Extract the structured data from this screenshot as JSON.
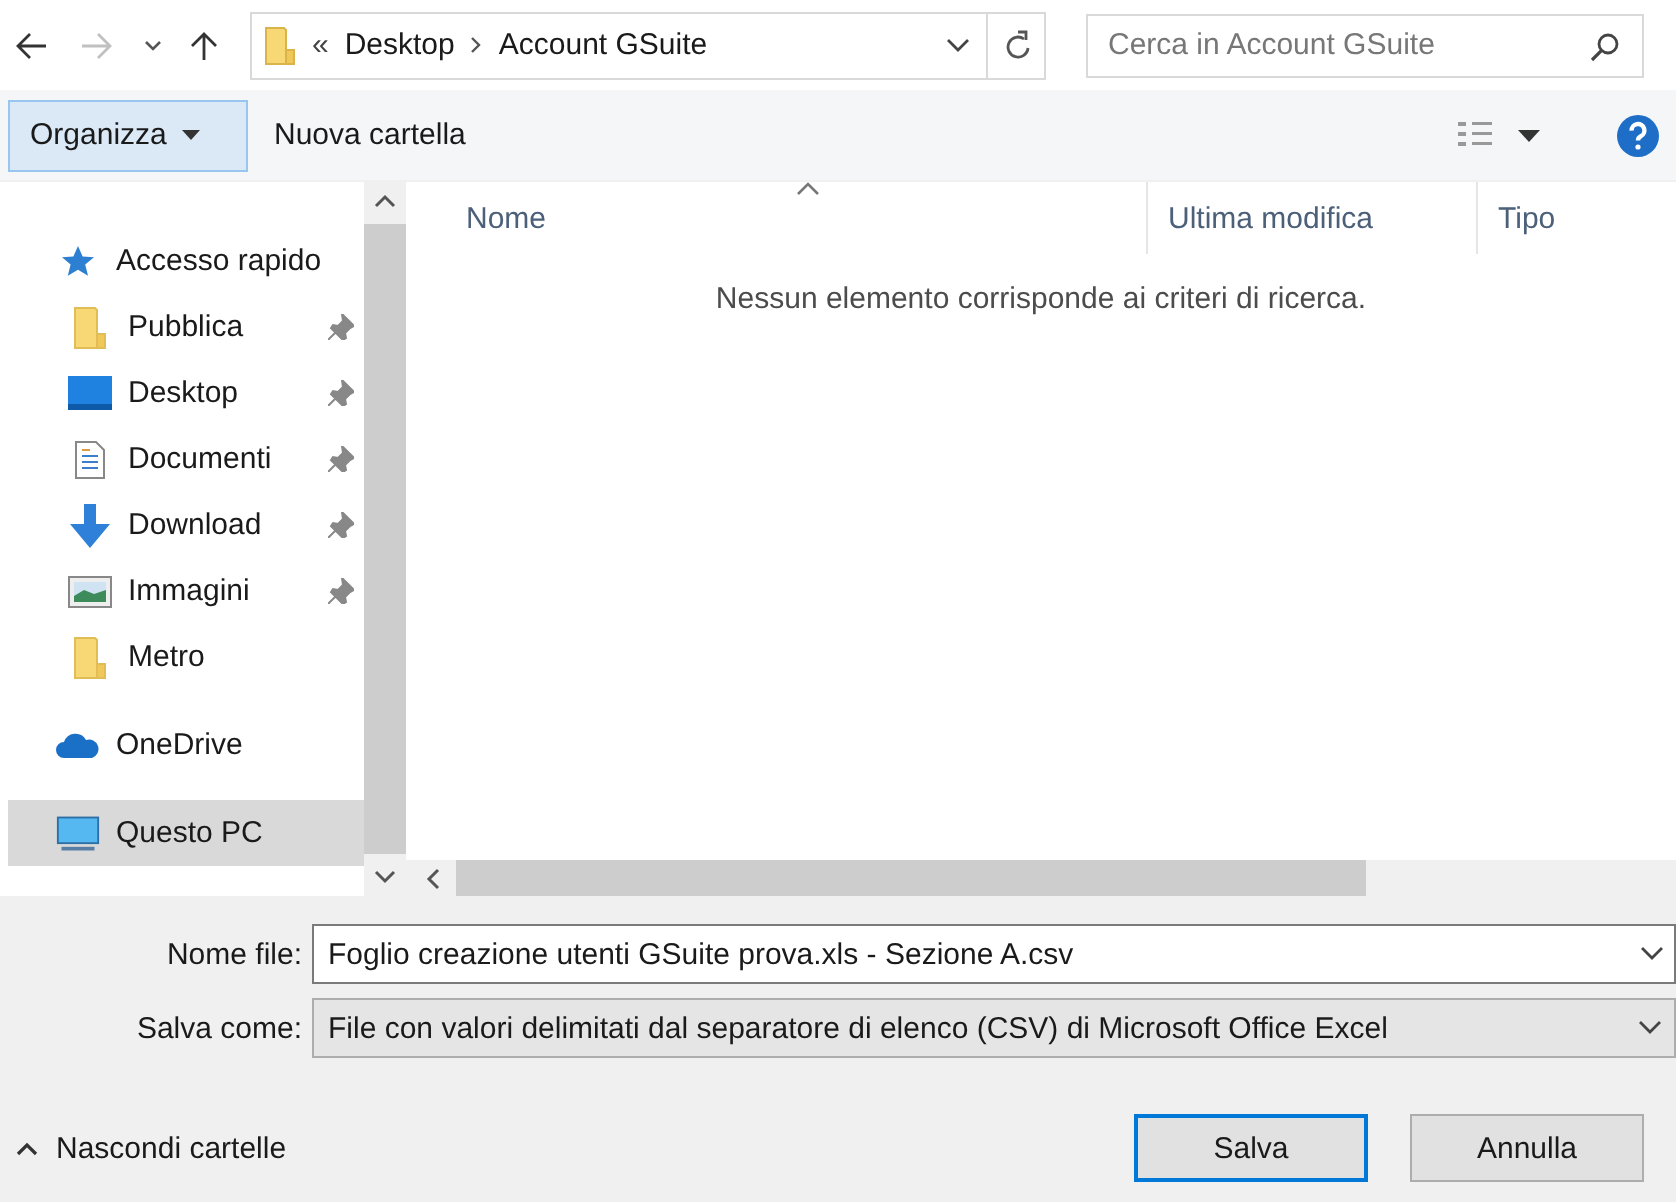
{
  "navigation": {
    "back_disabled": false,
    "forward_disabled": true,
    "path": [
      {
        "label": "Desktop"
      },
      {
        "label": "Account GSuite"
      }
    ],
    "overflow": "«",
    "search": {
      "placeholder": "Cerca in Account GSuite"
    }
  },
  "toolbar": {
    "buttons": [
      {
        "label": "Organizza",
        "kind": "menu",
        "selected": true
      },
      {
        "label": "Nuova cartella",
        "kind": "plain",
        "selected": false
      }
    ]
  },
  "sidebar": {
    "items": [
      {
        "label": "Accesso rapido",
        "kind": "star",
        "pinned": false,
        "selected": false,
        "children": [
          {
            "label": "Pubblica",
            "kind": "folder",
            "pinned": true,
            "selected": false
          },
          {
            "label": "Desktop",
            "kind": "desktop",
            "pinned": true,
            "selected": false
          },
          {
            "label": "Documenti",
            "kind": "document",
            "pinned": true,
            "selected": false
          },
          {
            "label": "Download",
            "kind": "download",
            "pinned": true,
            "selected": false
          },
          {
            "label": "Immagini",
            "kind": "image",
            "pinned": true,
            "selected": false
          },
          {
            "label": "Metro",
            "kind": "folder",
            "pinned": false,
            "selected": false
          }
        ]
      },
      {
        "label": "OneDrive",
        "kind": "cloud",
        "pinned": false,
        "selected": false
      },
      {
        "label": "Questo PC",
        "kind": "pc",
        "pinned": false,
        "selected": true
      }
    ]
  },
  "file_list": {
    "columns": [
      {
        "label": "Nome",
        "sorted": true
      },
      {
        "label": "Ultima modifica",
        "sorted": false
      },
      {
        "label": "Tipo",
        "sorted": false
      }
    ],
    "empty_message": "Nessun elemento corrisponde ai criteri di ricerca."
  },
  "form": {
    "file_name": {
      "label": "Nome file:",
      "value": "Foglio creazione utenti GSuite prova.xls - Sezione A.csv"
    },
    "save_as": {
      "label": "Salva come:",
      "value": "File con valori delimitati dal separatore di elenco (CSV) di Microsoft Office Excel"
    }
  },
  "footer": {
    "toggle": "Nascondi cartelle",
    "buttons": [
      {
        "label": "Salva",
        "selected": true
      },
      {
        "label": "Annulla",
        "selected": false
      }
    ]
  }
}
